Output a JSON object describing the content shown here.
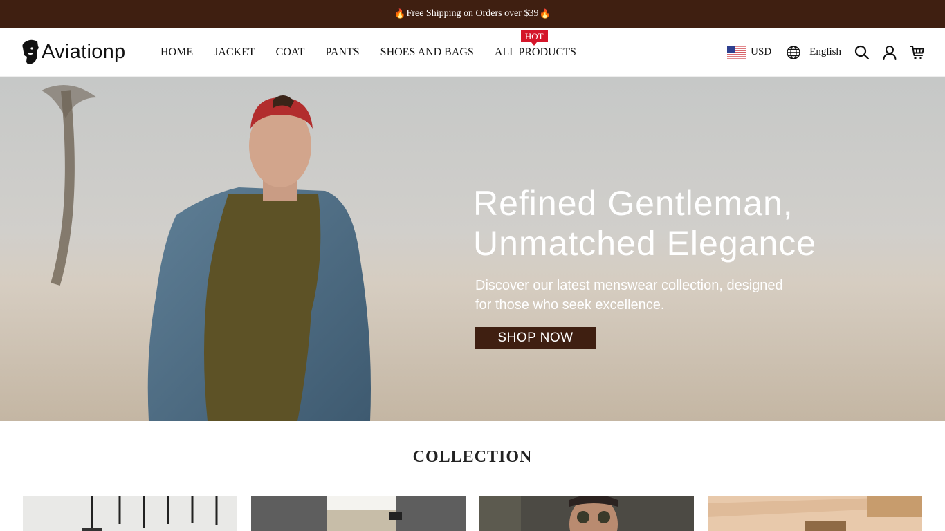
{
  "announcement": {
    "text": "Free Shipping on Orders over $39",
    "icon": "fire-icon"
  },
  "brand": {
    "name": "Aviationp",
    "logo_icon": "bearded-man-icon"
  },
  "nav": {
    "items": [
      {
        "label": "HOME"
      },
      {
        "label": "JACKET"
      },
      {
        "label": "COAT"
      },
      {
        "label": "PANTS"
      },
      {
        "label": "SHOES AND BAGS"
      },
      {
        "label": "ALL PRODUCTS",
        "badge": "HOT"
      }
    ]
  },
  "tools": {
    "currency": "USD",
    "currency_flag": "us-flag-icon",
    "language": "English",
    "icons": [
      "globe-icon",
      "search-icon",
      "user-icon",
      "cart-icon"
    ]
  },
  "hero": {
    "title": "Refined Gentleman,\nUnmatched Elegance",
    "subtitle": "Discover our latest menswear collection, designed for those who seek excellence.",
    "cta": "SHOP NOW"
  },
  "collection": {
    "title": "COLLECTION",
    "tiles": [
      "jacket-hangers-image",
      "pants-image",
      "sunglasses-man-image",
      "leather-goods-image"
    ]
  },
  "colors": {
    "brand_dark": "#3f1f11",
    "hot_badge": "#d4162a",
    "text": "#111111"
  }
}
